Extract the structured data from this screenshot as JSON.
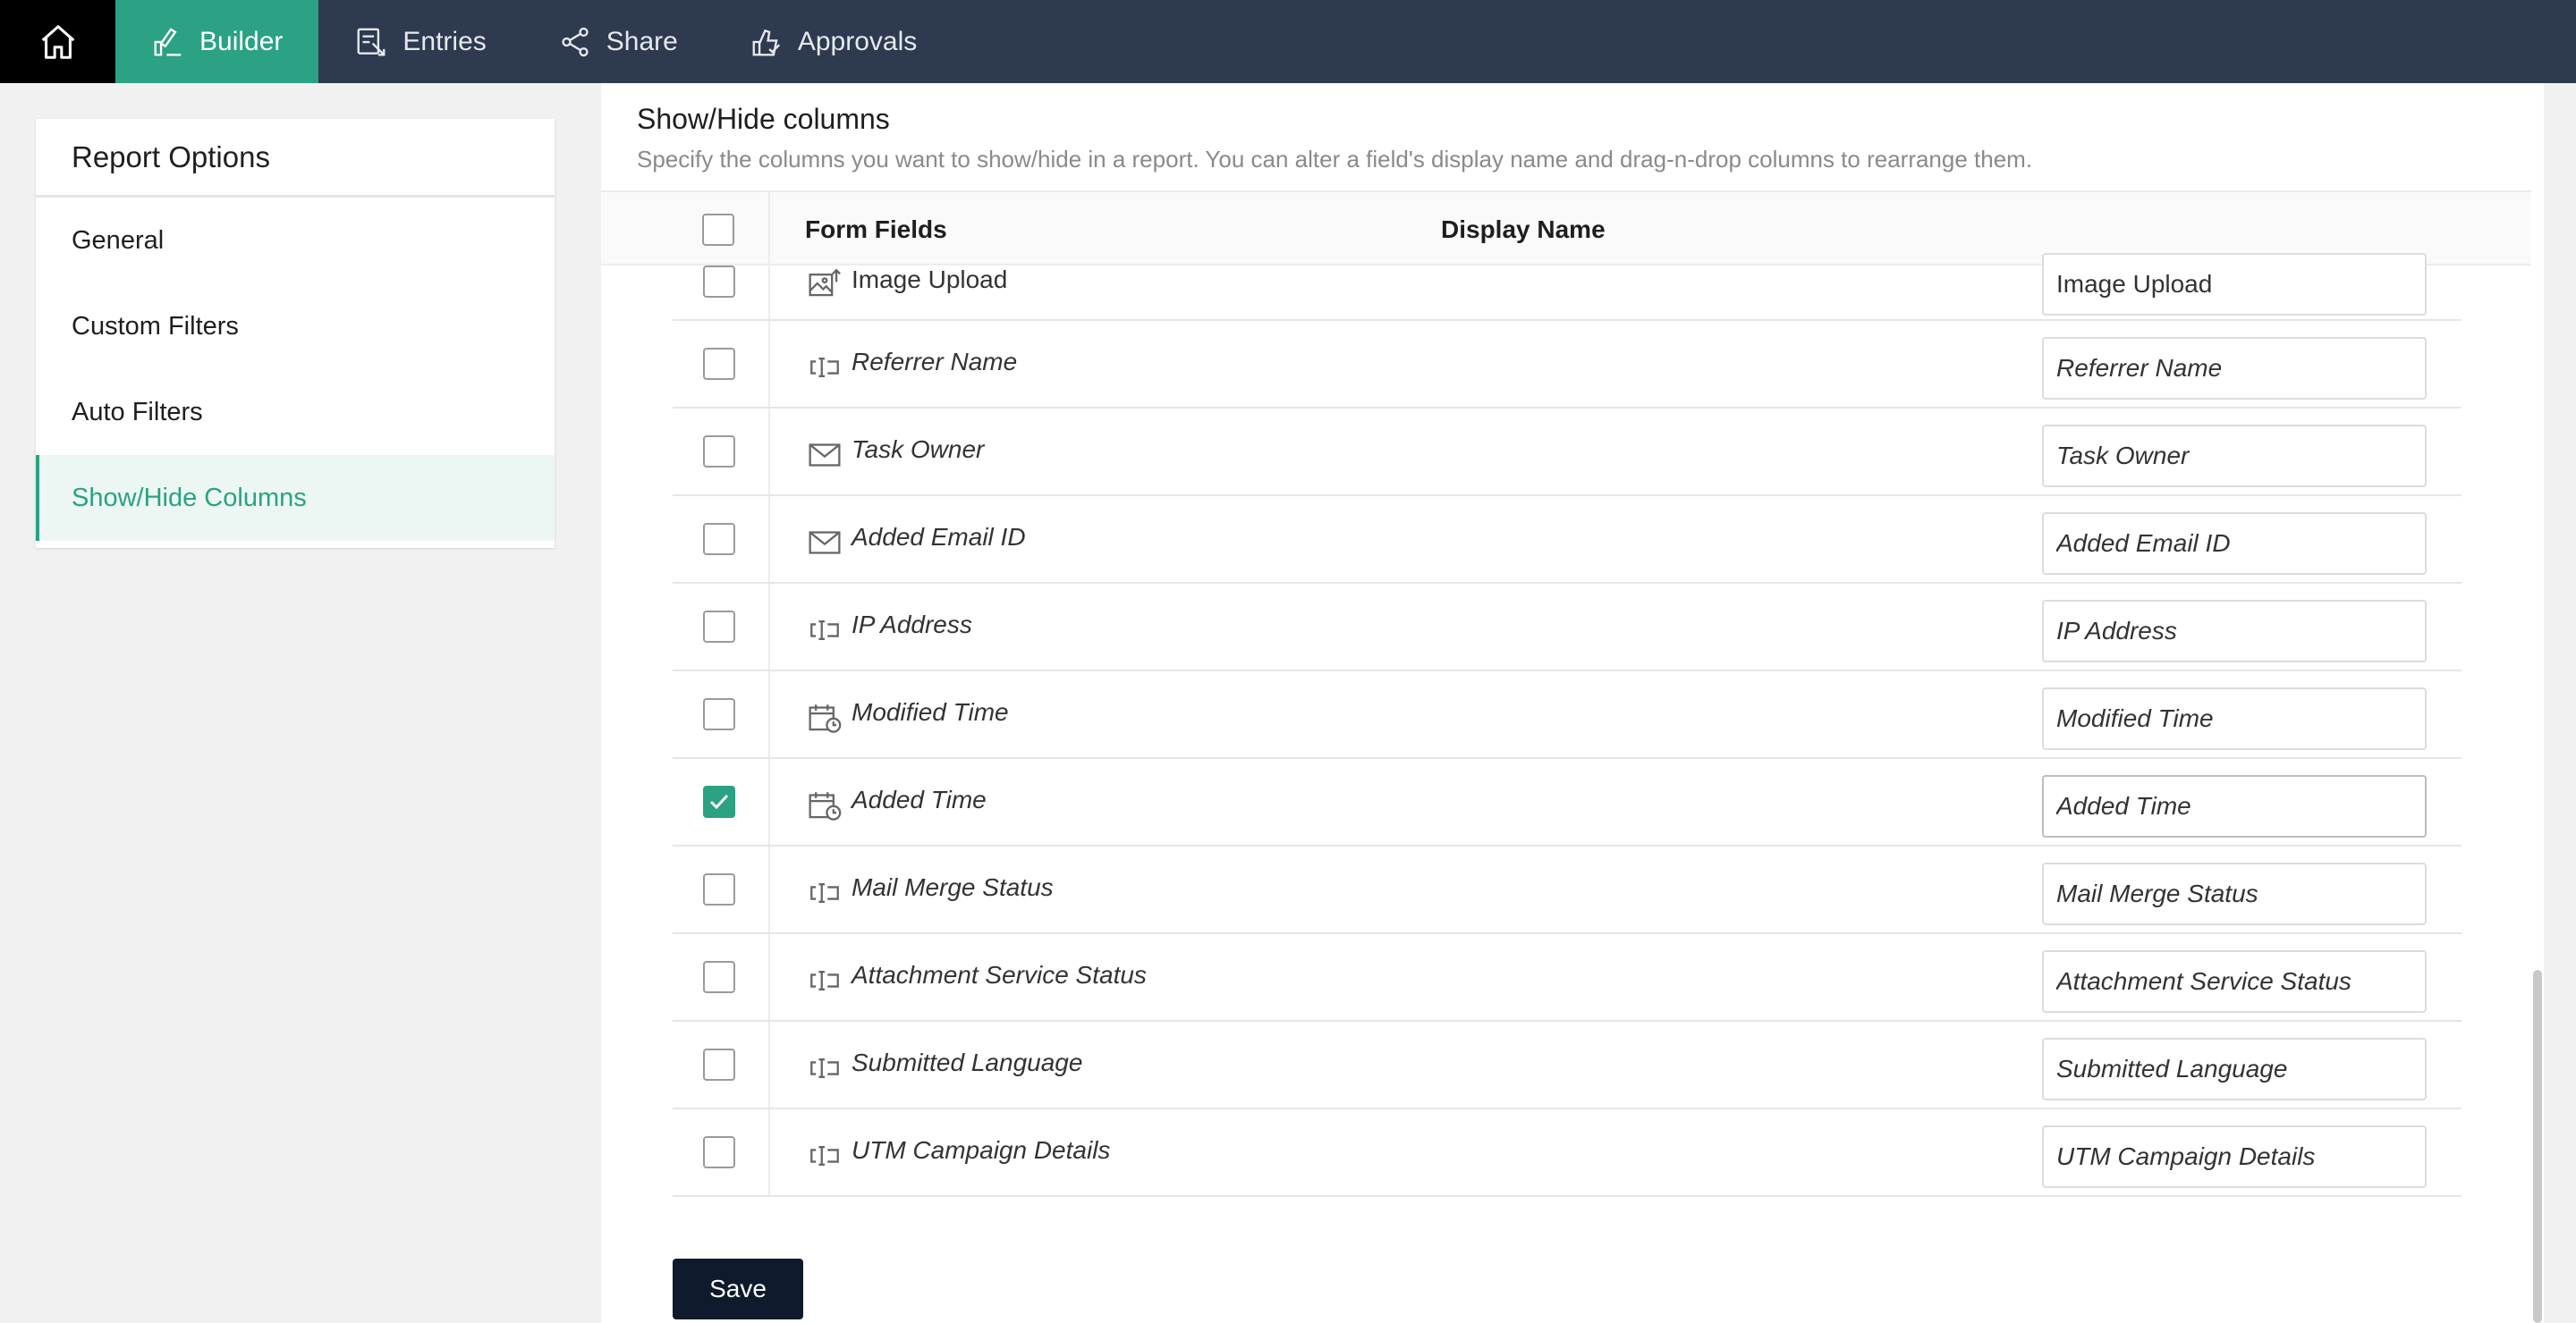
{
  "nav": {
    "items": [
      {
        "label": "Builder",
        "icon": "builder-icon",
        "active": true
      },
      {
        "label": "Entries",
        "icon": "entries-icon",
        "active": false
      },
      {
        "label": "Share",
        "icon": "share-icon",
        "active": false
      },
      {
        "label": "Approvals",
        "icon": "approvals-icon",
        "active": false
      }
    ]
  },
  "sidebar": {
    "title": "Report Options",
    "items": [
      {
        "label": "General",
        "active": false
      },
      {
        "label": "Custom Filters",
        "active": false
      },
      {
        "label": "Auto Filters",
        "active": false
      },
      {
        "label": "Show/Hide Columns",
        "active": true
      }
    ]
  },
  "main": {
    "title": "Show/Hide columns",
    "description": "Specify the columns you want to show/hide in a report. You can alter a field's display name and drag-n-drop columns to rearrange them.",
    "columns": {
      "form_fields": "Form Fields",
      "display_name": "Display Name"
    },
    "rows": [
      {
        "field": "Image Upload",
        "display": "Image Upload",
        "icon": "image-upload-icon",
        "checked": false
      },
      {
        "field": "Referrer Name",
        "display": "Referrer Name",
        "icon": "single-line-icon",
        "checked": false
      },
      {
        "field": "Task Owner",
        "display": "Task Owner",
        "icon": "email-icon",
        "checked": false
      },
      {
        "field": "Added Email ID",
        "display": "Added Email ID",
        "icon": "email-icon",
        "checked": false
      },
      {
        "field": "IP Address",
        "display": "IP Address",
        "icon": "single-line-icon",
        "checked": false
      },
      {
        "field": "Modified Time",
        "display": "Modified Time",
        "icon": "datetime-icon",
        "checked": false
      },
      {
        "field": "Added Time",
        "display": "Added Time",
        "icon": "datetime-icon",
        "checked": true
      },
      {
        "field": "Mail Merge Status",
        "display": "Mail Merge Status",
        "icon": "single-line-icon",
        "checked": false
      },
      {
        "field": "Attachment Service Status",
        "display": "Attachment Service Status",
        "icon": "single-line-icon",
        "checked": false
      },
      {
        "field": "Submitted Language",
        "display": "Submitted Language",
        "icon": "single-line-icon",
        "checked": false
      },
      {
        "field": "UTM Campaign Details",
        "display": "UTM Campaign Details",
        "icon": "single-line-icon",
        "checked": false
      }
    ],
    "save_label": "Save"
  },
  "colors": {
    "accent": "#2aa283",
    "topbar": "#2d3a4f",
    "save": "#0f1b2c"
  }
}
